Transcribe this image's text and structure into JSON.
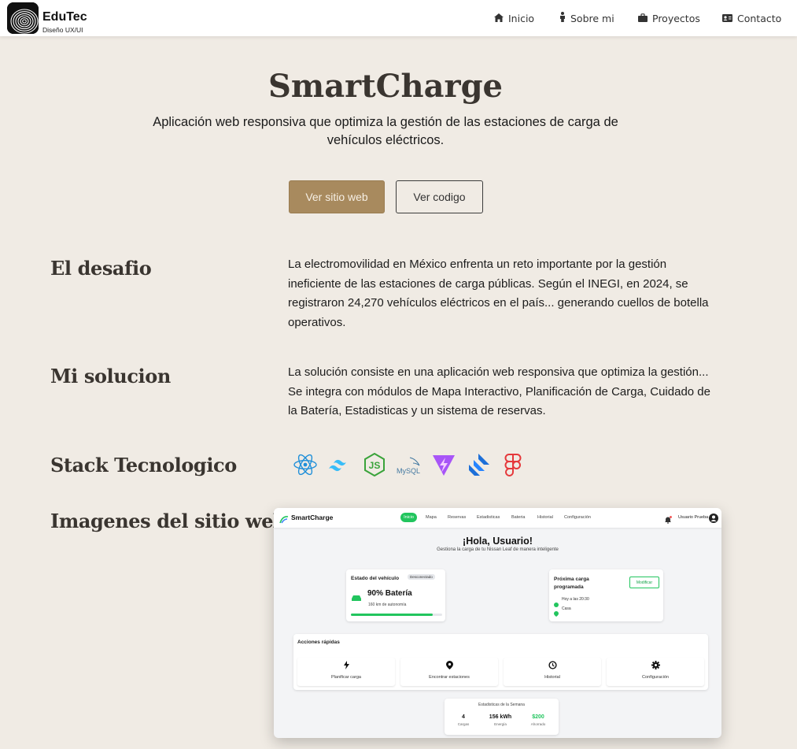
{
  "header": {
    "brand": "EduTec",
    "brand_sub": "Diseño UX/UI",
    "nav": [
      {
        "label": "Inicio",
        "icon": "home-icon"
      },
      {
        "label": "Sobre mi",
        "icon": "person-icon"
      },
      {
        "label": "Proyectos",
        "icon": "briefcase-icon"
      },
      {
        "label": "Contacto",
        "icon": "contact-card-icon"
      }
    ]
  },
  "hero": {
    "title": "SmartCharge",
    "subtitle": "Aplicación web responsiva que optimiza la gestión de las estaciones de carga de vehículos eléctricos.",
    "primary_button": "Ver sitio web",
    "secondary_button": "Ver codigo"
  },
  "sections": {
    "challenge_title": "El desafio",
    "challenge_text": "La electromovilidad en México enfrenta un reto importante por la gestión ineficiente de las estaciones de carga públicas. Según el INEGI, en 2024, se registraron 24,270 vehículos eléctricos en el país... generando cuellos de botella operativos.",
    "solution_title": "Mi solucion",
    "solution_text": "La solución consiste en una aplicación web responsiva que optimiza la gestión... Se integra con módulos de Mapa Interactivo, Planificación de Carga, Cuidado de la Batería, Estadisticas y un sistema de reservas.",
    "stack_title": "Stack Tecnologico",
    "stack": [
      "react-icon",
      "tailwind-icon",
      "nodejs-icon",
      "mysql-icon",
      "vite-icon",
      "jira-icon",
      "figma-icon"
    ],
    "stack_mysql_label": "MySQL",
    "images_title": "Imagenes del sitio web"
  },
  "screenshot": {
    "brand": "SmartCharge",
    "nav": [
      "Inicio",
      "Mapa",
      "Reservas",
      "Estadisticas",
      "Bateria",
      "Historial",
      "Configuración"
    ],
    "user": "Usuario Prueba",
    "greeting": "¡Hola, Usuario!",
    "greeting_sub": "Gestiona la carga de tu Nissan Leaf de manera inteligente",
    "vehicle_card": {
      "title": "Estado del vehículo",
      "badge": "Desconectado",
      "battery": "90% Batería",
      "range": "160 km de autonomía",
      "level": 0.9
    },
    "next_charge": {
      "title": "Próxima carga programada",
      "button": "Modificar",
      "time": "Hoy a las 20:30",
      "place": "Casa"
    },
    "quick_actions": {
      "title": "Acciones rápidas",
      "items": [
        "Planificar carga",
        "Encontrar estaciones",
        "Historial",
        "Configuración"
      ]
    },
    "stats": {
      "title": "Estadisticas de la Semana",
      "items": [
        {
          "value": "4",
          "label": "Cargas"
        },
        {
          "value": "156 kWh",
          "label": "Energía"
        },
        {
          "value": "$200",
          "label": "Ahorrado"
        }
      ]
    },
    "colors": {
      "accent": "#22c55e",
      "primary_button": "#a88a5e"
    }
  }
}
